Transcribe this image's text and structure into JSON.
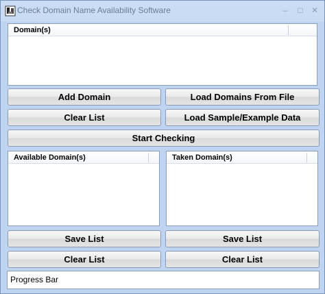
{
  "window": {
    "title": "Check Domain Name Availability Software",
    "controls": {
      "minimize": "–",
      "maximize": "□",
      "close": "✕"
    }
  },
  "domains_list": {
    "header": "Domain(s)"
  },
  "buttons": {
    "add_domain": "Add Domain",
    "load_from_file": "Load Domains From File",
    "clear_list": "Clear List",
    "load_sample": "Load Sample/Example Data",
    "start_checking": "Start Checking"
  },
  "available_list": {
    "header": "Available Domain(s)",
    "save": "Save List",
    "clear": "Clear List"
  },
  "taken_list": {
    "header": "Taken Domain(s)",
    "save": "Save List",
    "clear": "Clear List"
  },
  "progress": {
    "label": "Progress Bar"
  },
  "colors": {
    "background": "#bfd4f0",
    "titlebar": "#c9dcf3",
    "border": "#8c9db8"
  }
}
